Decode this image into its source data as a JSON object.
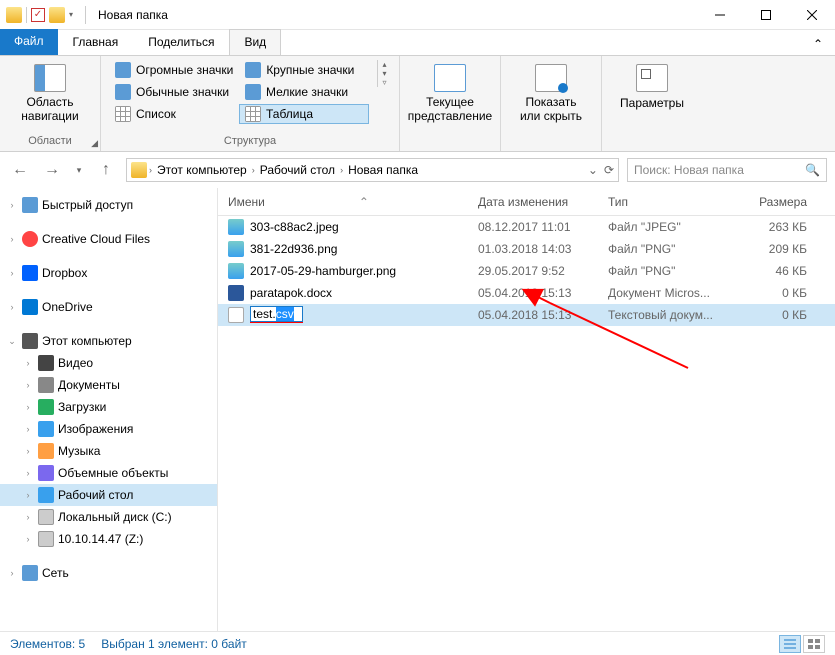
{
  "titlebar": {
    "title": "Новая папка"
  },
  "tabs": {
    "file": "Файл",
    "home": "Главная",
    "share": "Поделиться",
    "view": "Вид"
  },
  "ribbon": {
    "pane": {
      "label": "Область\nнавигации",
      "group": "Области"
    },
    "layout": {
      "huge": "Огромные значки",
      "large": "Крупные значки",
      "normal": "Обычные значки",
      "small": "Мелкие значки",
      "list": "Список",
      "table": "Таблица",
      "group": "Структура"
    },
    "view": {
      "label": "Текущее\nпредставление"
    },
    "show": {
      "label": "Показать\nили скрыть"
    },
    "opts": {
      "label": "Параметры"
    }
  },
  "breadcrumb": {
    "pc": "Этот компьютер",
    "desktop": "Рабочий стол",
    "folder": "Новая папка"
  },
  "search": {
    "placeholder": "Поиск: Новая папка"
  },
  "sidebar": {
    "quick": "Быстрый доступ",
    "cc": "Creative Cloud Files",
    "dropbox": "Dropbox",
    "onedrive": "OneDrive",
    "thispc": "Этот компьютер",
    "video": "Видео",
    "docs": "Документы",
    "downloads": "Загрузки",
    "pictures": "Изображения",
    "music": "Музыка",
    "objects": "Объемные объекты",
    "desktop": "Рабочий стол",
    "cdrive": "Локальный диск (C:)",
    "zdrive": "10.10.14.47 (Z:)",
    "network": "Сеть"
  },
  "columns": {
    "name": "Имени",
    "date": "Дата изменения",
    "type": "Тип",
    "size": "Размера"
  },
  "files": [
    {
      "name": "303-c88ac2.jpeg",
      "date": "08.12.2017 11:01",
      "type": "Файл \"JPEG\"",
      "size": "263 КБ",
      "ic": "img"
    },
    {
      "name": "381-22d936.png",
      "date": "01.03.2018 14:03",
      "type": "Файл \"PNG\"",
      "size": "209 КБ",
      "ic": "img"
    },
    {
      "name": "2017-05-29-hamburger.png",
      "date": "29.05.2017 9:52",
      "type": "Файл \"PNG\"",
      "size": "46 КБ",
      "ic": "img"
    },
    {
      "name": "paratapok.docx",
      "date": "05.04.2018 15:13",
      "type": "Документ Micros...",
      "size": "0 КБ",
      "ic": "doc"
    }
  ],
  "editing": {
    "base": "test.",
    "sel": "csv",
    "date": "05.04.2018 15:13",
    "type": "Текстовый докум...",
    "size": "0 КБ"
  },
  "status": {
    "count": "Элементов: 5",
    "selected": "Выбран 1 элемент: 0 байт"
  }
}
